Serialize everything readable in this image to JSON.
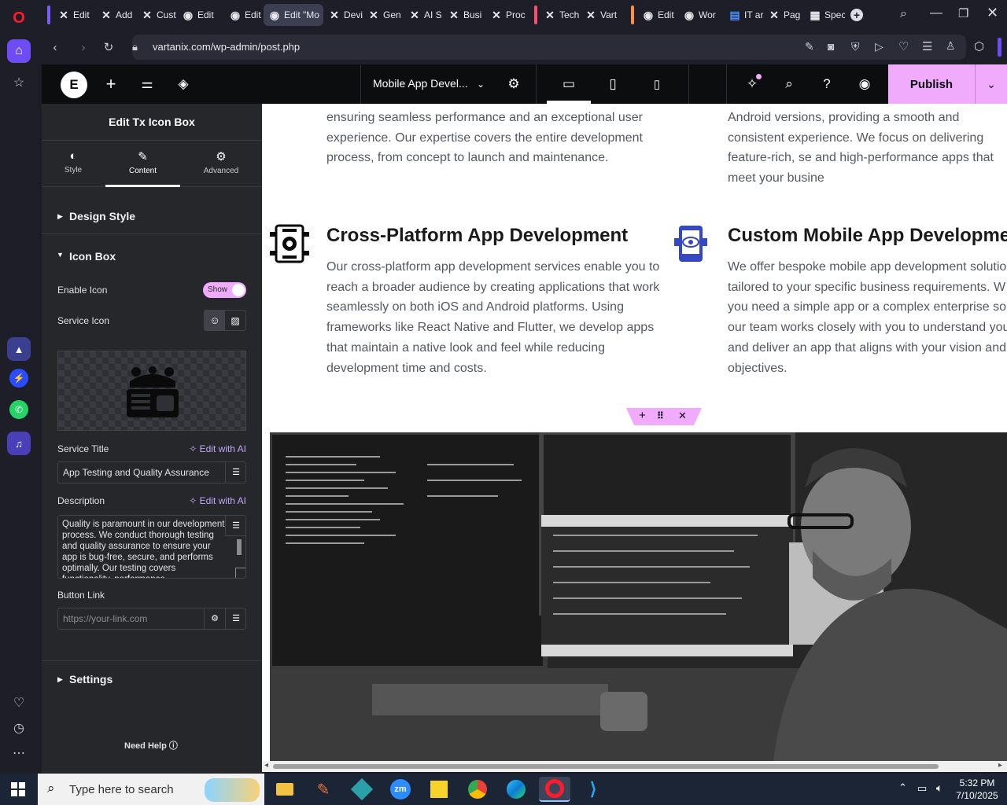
{
  "browser": {
    "url": "vartanix.com/wp-admin/post.php",
    "tabs": [
      {
        "label": "Edit",
        "icon": "x-icon"
      },
      {
        "label": "Add",
        "icon": "x-icon"
      },
      {
        "label": "Cust",
        "icon": "x-icon"
      },
      {
        "label": "Edit",
        "icon": "wp-icon"
      },
      {
        "label": "Edit",
        "icon": "wp-icon"
      },
      {
        "label": "Edit \"Mo",
        "icon": "wp-icon"
      },
      {
        "label": "Devi",
        "icon": "x-icon"
      },
      {
        "label": "Gen",
        "icon": "x-icon"
      },
      {
        "label": "AI S",
        "icon": "x-icon"
      },
      {
        "label": "Busi",
        "icon": "x-icon"
      },
      {
        "label": "Proc",
        "icon": "x-icon"
      },
      {
        "label": "Tech",
        "icon": "x-icon"
      },
      {
        "label": "Vart",
        "icon": "x-icon"
      },
      {
        "label": "Edit",
        "icon": "wp-icon"
      },
      {
        "label": "Wor",
        "icon": "wp-icon"
      },
      {
        "label": "IT ar",
        "icon": "doc-icon"
      },
      {
        "label": "Pag",
        "icon": "x-icon"
      },
      {
        "label": "Spec",
        "icon": "grid-icon"
      }
    ]
  },
  "topbar": {
    "page_name": "Mobile App Devel...",
    "publish_label": "Publish"
  },
  "panel": {
    "title": "Edit Tx Icon Box",
    "tabs": [
      "Style",
      "Content",
      "Advanced"
    ],
    "active_tab": "Content",
    "design_style_label": "Design Style",
    "icon_box_label": "Icon Box",
    "enable_icon_label": "Enable Icon",
    "enable_icon_value": "Show",
    "service_icon_label": "Service Icon",
    "service_title_label": "Service Title",
    "edit_ai_label": "Edit with AI",
    "service_title_value": "App Testing and Quality Assurance",
    "description_label": "Description",
    "description_value": "Quality is paramount in our development process. We conduct thorough testing and quality assurance to ensure your app is bug-free, secure, and performs optimally. Our testing covers functionality, performance",
    "button_link_label": "Button Link",
    "button_link_placeholder": "https://your-link.com",
    "settings_label": "Settings",
    "need_help_label": "Need Help"
  },
  "canvas": {
    "top_left_text": "ensuring seamless performance and an exceptional user experience. Our expertise covers the entire development process, from concept to launch and maintenance.",
    "top_right_text": "Android versions, providing a smooth and consistent experience. We focus on delivering feature-rich, se and high-performance apps that meet your busine",
    "services": [
      {
        "title": "Cross-Platform App Development",
        "description": "Our cross-platform app development services enable you to reach a broader audience by creating applications that work seamlessly on both iOS and Android platforms. Using frameworks like React Native and Flutter, we develop apps that maintain a native look and feel while reducing development time and costs."
      },
      {
        "title": "Custom Mobile App Development",
        "description": "We offer bespoke mobile app development solutio tailored to your specific business requirements. W you need a simple app or a complex enterprise sol our team works closely with you to understand you and deliver an app that aligns with your vision and objectives."
      }
    ]
  },
  "taskbar": {
    "search_placeholder": "Type here to search",
    "time": "5:32 PM",
    "date": "7/10/2025"
  },
  "colors": {
    "accent_pink": "#f0abfc",
    "panel_bg": "#26272b",
    "topbar_bg": "#0c0d0e"
  }
}
